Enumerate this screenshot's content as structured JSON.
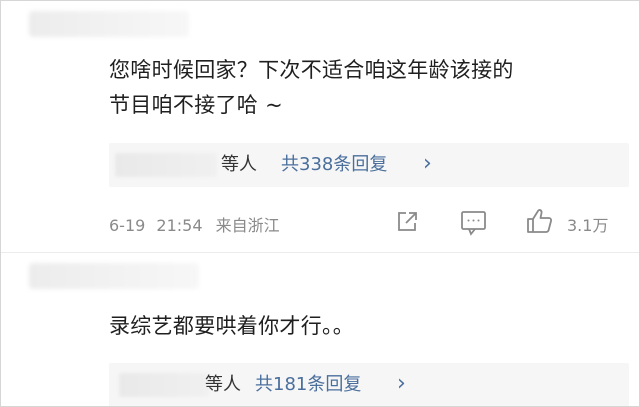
{
  "comments": [
    {
      "text_line1": "您啥时候回家？下次不适合咱这年龄该接的",
      "text_line2": "节目咱不接了哈 ~",
      "reply_names_suffix": "等人",
      "reply_count": "共338条回复",
      "reply_chevron": "›",
      "date": "6-19",
      "time": "21:54",
      "location": "来自浙江",
      "likes": "3.1万"
    },
    {
      "text_line1": "录综艺都要哄着你才行。。",
      "reply_names_suffix": "等人",
      "reply_count": "共181条回复",
      "reply_chevron": "›"
    }
  ],
  "icons": {
    "share": "share-icon",
    "comment": "comment-icon",
    "like": "thumbs-up-icon",
    "chevron": "chevron-right-icon"
  },
  "colors": {
    "link": "#4a6f9c",
    "meta": "#8a8a8a",
    "text": "#1f1f1f",
    "reply_bg": "#f6f6f6"
  }
}
